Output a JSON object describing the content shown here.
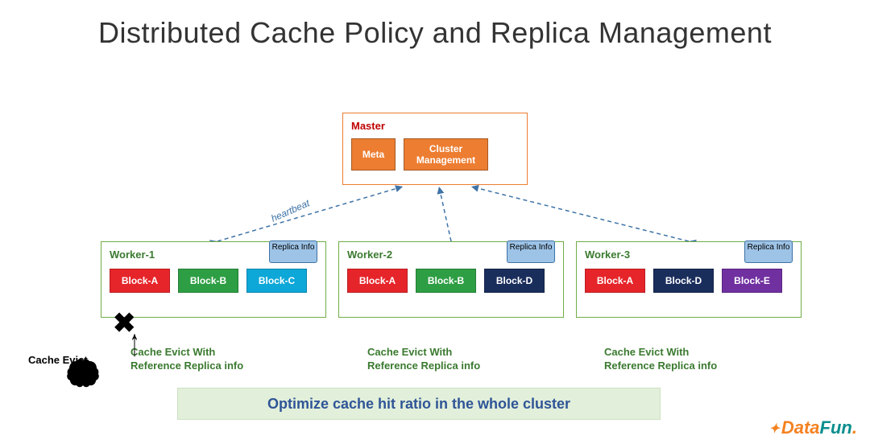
{
  "title": "Distributed Cache Policy and Replica Management",
  "master": {
    "label": "Master",
    "meta": "Meta",
    "cluster": "Cluster\nManagement"
  },
  "heartbeat_label": "heartbeat",
  "replica_info_label": "Replica\nInfo",
  "workers": [
    {
      "label": "Worker-1",
      "blocks": [
        "Block-A",
        "Block-B",
        "Block-C"
      ],
      "colors": [
        "red",
        "green",
        "cyan"
      ]
    },
    {
      "label": "Worker-2",
      "blocks": [
        "Block-A",
        "Block-B",
        "Block-D"
      ],
      "colors": [
        "red",
        "green",
        "navy"
      ]
    },
    {
      "label": "Worker-3",
      "blocks": [
        "Block-A",
        "Block-D",
        "Block-E"
      ],
      "colors": [
        "red",
        "navy",
        "purple"
      ]
    }
  ],
  "evict_caption": "Cache Evict With\nReference Replica info",
  "cache_evict_label": "Cache Evict",
  "optimize_text": "Optimize cache hit ratio in the whole cluster",
  "logo": {
    "part1": "Data",
    "part2": "Fun",
    "dot": "."
  }
}
